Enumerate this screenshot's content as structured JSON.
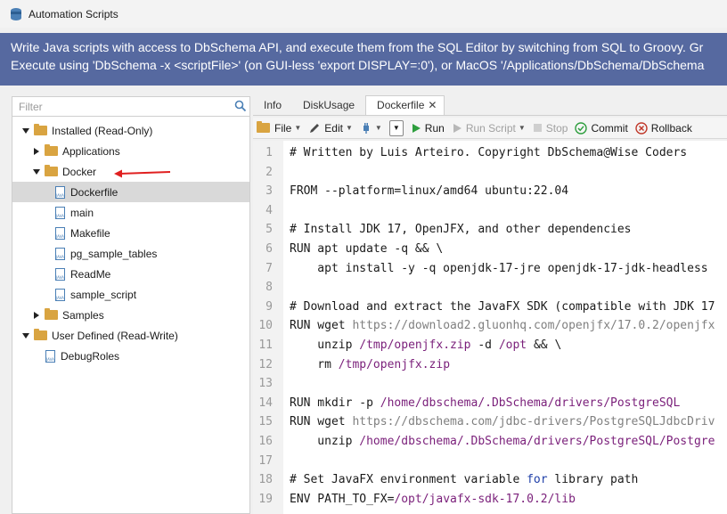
{
  "window": {
    "title": "Automation Scripts"
  },
  "banner": {
    "line1": "Write Java scripts with access to DbSchema API, and execute them from the SQL Editor by switching from SQL to Groovy. Gr",
    "line2": "Execute using 'DbSchema -x <scriptFile>' (on GUI-less 'export DISPLAY=:0'), or MacOS '/Applications/DbSchema/DbSchema"
  },
  "filter": {
    "placeholder": "Filter"
  },
  "tree": [
    {
      "label": "Installed (Read-Only)",
      "type": "folder",
      "expanded": true,
      "level": 0
    },
    {
      "label": "Applications",
      "type": "folder",
      "expanded": false,
      "level": 1
    },
    {
      "label": "Docker",
      "type": "folder",
      "expanded": true,
      "level": 1
    },
    {
      "label": "Dockerfile",
      "type": "file",
      "level": 2,
      "selected": true
    },
    {
      "label": "main",
      "type": "file",
      "level": 2
    },
    {
      "label": "Makefile",
      "type": "file",
      "level": 2
    },
    {
      "label": "pg_sample_tables",
      "type": "file",
      "level": 2
    },
    {
      "label": "ReadMe",
      "type": "file",
      "level": 2
    },
    {
      "label": "sample_script",
      "type": "file",
      "level": 2
    },
    {
      "label": "Samples",
      "type": "folder",
      "expanded": false,
      "level": 1
    },
    {
      "label": "User Defined (Read-Write)",
      "type": "folder",
      "expanded": true,
      "level": 0
    },
    {
      "label": "DebugRoles",
      "type": "file",
      "level": 1
    }
  ],
  "tabs": [
    {
      "label": "Info",
      "active": false
    },
    {
      "label": "DiskUsage",
      "active": false
    },
    {
      "label": "Dockerfile",
      "active": true
    }
  ],
  "toolbar": {
    "file": "File",
    "edit": "Edit",
    "run": "Run",
    "run_script": "Run Script",
    "stop": "Stop",
    "commit": "Commit",
    "rollback": "Rollback"
  },
  "colors": {
    "banner_bg": "#5669a0",
    "selected_row": "#d9d9d9",
    "run_green": "#2e9e3e",
    "rollback_red": "#c0392b",
    "annotation_arrow": "#e02020"
  },
  "code_lines": [
    {
      "n": "1",
      "text": "# Written by Luis Arteiro. Copyright DbSchema@Wise Coders"
    },
    {
      "n": "2",
      "text": ""
    },
    {
      "n": "3",
      "text": "FROM --platform=linux/amd64 ubuntu:22.04"
    },
    {
      "n": "4",
      "text": ""
    },
    {
      "n": "5",
      "text": "# Install JDK 17, OpenJFX, and other dependencies"
    },
    {
      "n": "6",
      "text": "RUN apt update -q && \\"
    },
    {
      "n": "7",
      "text": "    apt install -y -q openjdk-17-jre openjdk-17-jdk-headless"
    },
    {
      "n": "8",
      "text": ""
    },
    {
      "n": "9",
      "text": "# Download and extract the JavaFX SDK (compatible with JDK 17"
    },
    {
      "n": "10",
      "text": "RUN wget https://download2.gluonhq.com/openjfx/17.0.2/openjfx"
    },
    {
      "n": "11",
      "text": "    unzip /tmp/openjfx.zip -d /opt && \\"
    },
    {
      "n": "12",
      "text": "    rm /tmp/openjfx.zip"
    },
    {
      "n": "13",
      "text": ""
    },
    {
      "n": "14",
      "text": "RUN mkdir -p /home/dbschema/.DbSchema/drivers/PostgreSQL"
    },
    {
      "n": "15",
      "text": "RUN wget https://dbschema.com/jdbc-drivers/PostgreSQLJdbcDriv"
    },
    {
      "n": "16",
      "text": "    unzip /home/dbschema/.DbSchema/drivers/PostgreSQL/Postgre"
    },
    {
      "n": "17",
      "text": ""
    },
    {
      "n": "18",
      "text": "# Set JavaFX environment variable for library path"
    },
    {
      "n": "19",
      "text": "ENV PATH_TO_FX=/opt/javafx-sdk-17.0.2/lib"
    }
  ]
}
